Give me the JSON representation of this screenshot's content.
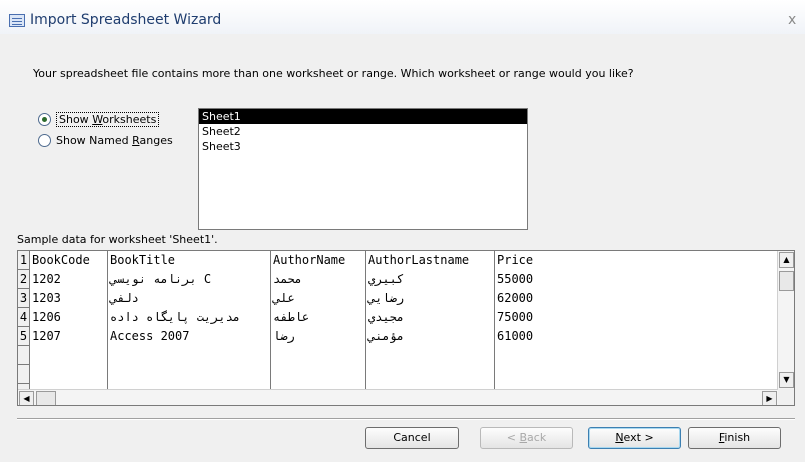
{
  "window": {
    "title": "Import Spreadsheet Wizard",
    "close_glyph": "x"
  },
  "question": "Your spreadsheet file contains more than one worksheet or range. Which worksheet or range would you like?",
  "options": {
    "show_worksheets": {
      "pre": "Show ",
      "ul": "W",
      "post": "orksheets",
      "selected": true
    },
    "show_named_ranges": {
      "pre": "Show Named ",
      "ul": "R",
      "post": "anges",
      "selected": false
    }
  },
  "sheets": [
    "Sheet1",
    "Sheet2",
    "Sheet3"
  ],
  "selected_sheet": "Sheet1",
  "sample_label": "Sample data for worksheet 'Sheet1'.",
  "grid": {
    "row_numbers": [
      "1",
      "2",
      "3",
      "4",
      "5",
      "",
      ""
    ],
    "columns": [
      {
        "cells": [
          "BookCode",
          "1202",
          "1203",
          "1206",
          "1207",
          "",
          ""
        ]
      },
      {
        "cells": [
          "BookTitle",
          "برنامه نويسي C",
          "دلفي",
          "مديريت پايگاه داده",
          "Access 2007",
          "",
          ""
        ]
      },
      {
        "cells": [
          "AuthorName",
          "محمد",
          "علي",
          "عاطفه",
          "رضا",
          "",
          ""
        ]
      },
      {
        "cells": [
          "AuthorLastname",
          "كبيري",
          "رضايي",
          "مجيدي",
          "مؤمني",
          "",
          ""
        ]
      },
      {
        "cells": [
          "Price",
          "55000",
          "62000",
          "75000",
          "61000",
          "",
          ""
        ]
      }
    ]
  },
  "buttons": {
    "cancel": {
      "label": "Cancel"
    },
    "back": {
      "pre": "< ",
      "ul": "B",
      "post": "ack"
    },
    "next": {
      "ul": "N",
      "post": "ext >"
    },
    "finish": {
      "ul": "F",
      "post": "inish"
    }
  },
  "scroll": {
    "up_arrow": "▲",
    "down_arrow": "▼",
    "left_arrow": "◀",
    "right_arrow": "▶"
  }
}
